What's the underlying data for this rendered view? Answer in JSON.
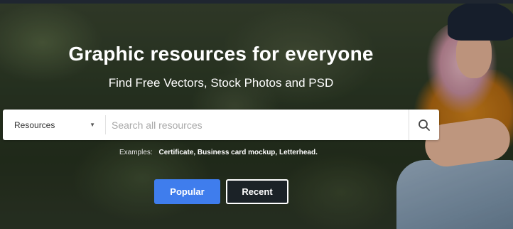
{
  "hero": {
    "title": "Graphic resources for everyone",
    "subtitle": "Find Free Vectors, Stock Photos and PSD"
  },
  "search": {
    "category_selected": "Resources",
    "placeholder": "Search all resources",
    "search_icon": "magnifier-icon"
  },
  "examples": {
    "label": "Examples:",
    "items": "Certificate, Business card mockup, Letterhead."
  },
  "buttons": {
    "popular": "Popular",
    "recent": "Recent"
  },
  "colors": {
    "accent": "#3f7ded",
    "recent_bg": "#1b2227"
  }
}
